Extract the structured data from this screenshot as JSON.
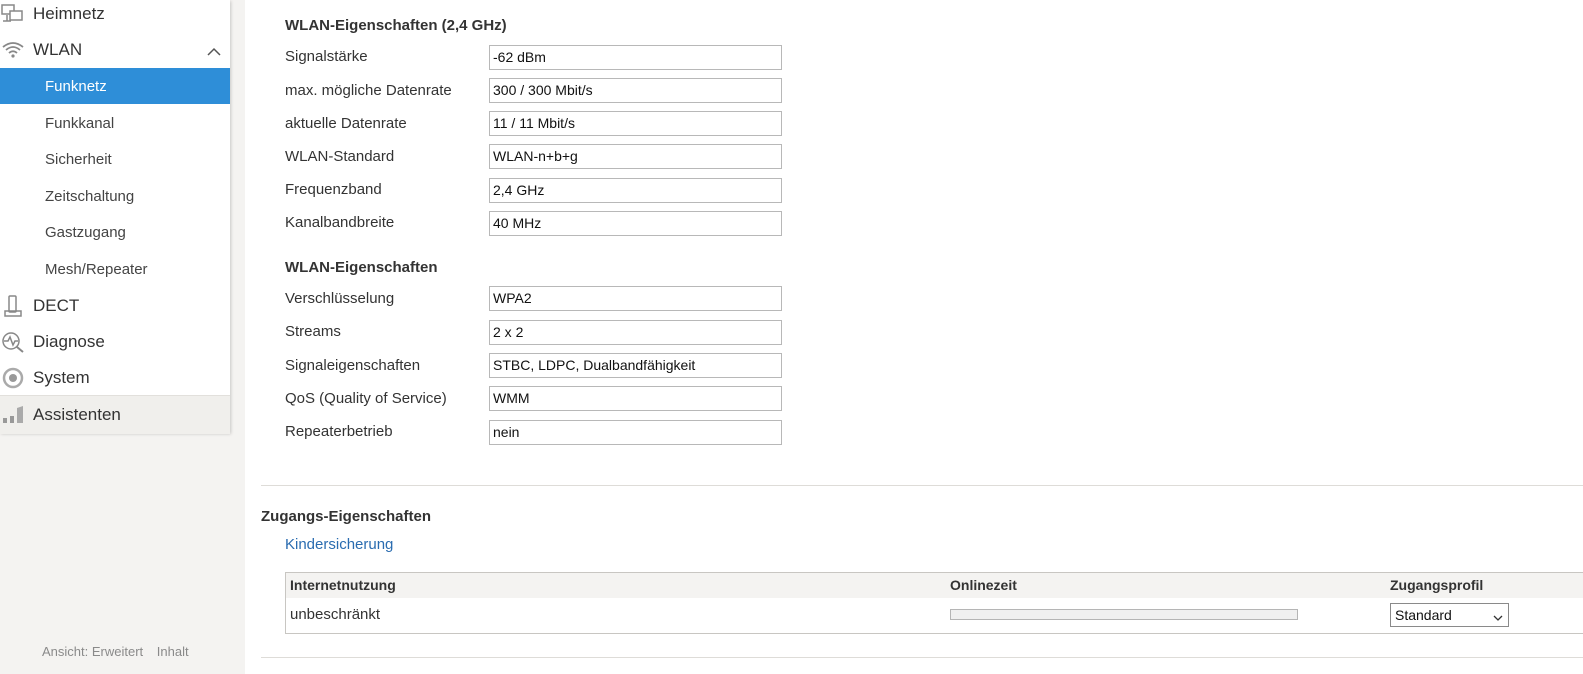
{
  "sidebar": {
    "main_items": [
      {
        "label": "Heimnetz",
        "icon": "network-icon"
      },
      {
        "label": "WLAN",
        "icon": "wifi-icon"
      },
      {
        "label": "DECT",
        "icon": "phone-icon"
      },
      {
        "label": "Diagnose",
        "icon": "diagnose-icon"
      },
      {
        "label": "System",
        "icon": "gear-icon"
      }
    ],
    "sub_items": [
      {
        "label": "Funknetz"
      },
      {
        "label": "Funkkanal"
      },
      {
        "label": "Sicherheit"
      },
      {
        "label": "Zeitschaltung"
      },
      {
        "label": "Gastzugang"
      },
      {
        "label": "Mesh/Repeater"
      }
    ],
    "assistant": {
      "label": "Assistenten",
      "icon": "wizard-icon"
    },
    "footer": {
      "view": "Ansicht: Erweitert",
      "content": "Inhalt"
    }
  },
  "wlan_24": {
    "title": "WLAN-Eigenschaften (2,4 GHz)",
    "rows": [
      {
        "label": "Signalstärke",
        "value": "-62 dBm"
      },
      {
        "label": "max. mögliche Datenrate",
        "value": "300 / 300 Mbit/s"
      },
      {
        "label": "aktuelle Datenrate",
        "value": "11 / 11 Mbit/s"
      },
      {
        "label": "WLAN-Standard",
        "value": "WLAN-n+b+g"
      },
      {
        "label": "Frequenzband",
        "value": "2,4 GHz"
      },
      {
        "label": "Kanalbandbreite",
        "value": "40 MHz"
      }
    ]
  },
  "wlan_props": {
    "title": "WLAN-Eigenschaften",
    "rows": [
      {
        "label": "Verschlüsselung",
        "value": "WPA2"
      },
      {
        "label": "Streams",
        "value": "2 x 2"
      },
      {
        "label": "Signaleigenschaften",
        "value": "STBC, LDPC, Dualbandfähigkeit"
      },
      {
        "label": "QoS (Quality of Service)",
        "value": "WMM"
      },
      {
        "label": "Repeaterbetrieb",
        "value": "nein"
      }
    ]
  },
  "access": {
    "title": "Zugangs-Eigenschaften",
    "link": "Kindersicherung",
    "table": {
      "headers": [
        "Internetnutzung",
        "Onlinezeit",
        "Zugangsprofil"
      ],
      "row": {
        "usage": "unbeschränkt",
        "online_fraction": 0,
        "profile": "Standard"
      }
    }
  },
  "colors": {
    "accent": "#2e8ed8",
    "link": "#2a6cb0"
  }
}
